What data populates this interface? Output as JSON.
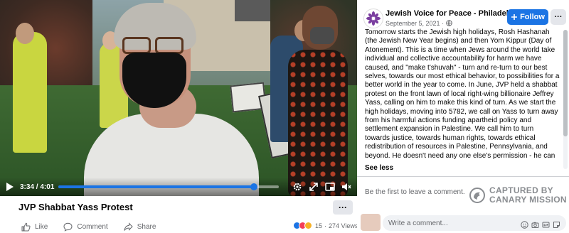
{
  "video": {
    "current_time": "3:34",
    "duration": "4:01",
    "progress_fraction": 0.888
  },
  "post": {
    "title": "JVP Shabbat Yass Protest",
    "more_label": "···",
    "actions": {
      "like": "Like",
      "comment": "Comment",
      "share": "Share"
    },
    "reaction_count": "15",
    "views": "274 Views",
    "views_separator": "·"
  },
  "panel": {
    "page_name": "Jewish Voice for Peace - Philadelphia",
    "date": "September 5, 2021",
    "date_suffix": "·",
    "follow_label": "Follow",
    "more_label": "···",
    "body": "Tomorrow starts the Jewish high holidays, Rosh Hashanah (the Jewish New Year begins) and then Yom Kippur (Day of Atonement). This is a time when Jews around the world take individual and collective accountability for harm we have caused, and \"make t'shuvah\" - turn and re-turn to our best selves, towards our most ethical behavior, to possibilities for a better world in the year to come. In June, JVP held a shabbat protest on the front lawn of local right-wing billionaire Jeffrey Yass, calling on him to make this kind of turn. As we start the high holidays, moving into 5782, we call on Yass to turn away from his harmful actions funding apartheid policy and settlement expansion in Palestine. We call him to turn towards justice, towards human rights, towards ethical redistribution of resources in Palestine, Pennsylvania, and beyond. He doesn't need any one else's permission - he can stop his harmful actions today. We call on Yass to cease his support for people and policies that cause suffering and destruction. We call",
    "see_less": "See less",
    "first_comment": "Be the first to leave a comment.",
    "comment_placeholder": "Write a comment..."
  },
  "watermark": {
    "line1": "CAPTURED BY",
    "line2": "CANARY MISSION"
  },
  "colors": {
    "accent": "#1b74e4",
    "text_secondary": "#65676b",
    "watermark": "#8a8d91"
  }
}
